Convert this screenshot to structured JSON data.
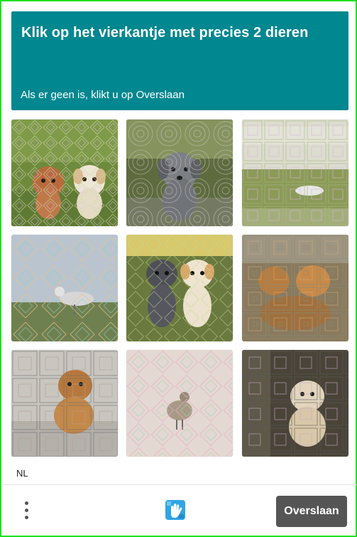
{
  "header": {
    "title": "Klik op het vierkantje met precies 2 dieren",
    "subtitle": "Als er geen is, klikt u op Overslaan",
    "background": "#00878f"
  },
  "grid": {
    "tiles": [
      {
        "id": 1,
        "content": "two puppies on grass"
      },
      {
        "id": 2,
        "content": "grey puppy"
      },
      {
        "id": 3,
        "content": "bird on field"
      },
      {
        "id": 4,
        "content": "seagull"
      },
      {
        "id": 5,
        "content": "two puppies"
      },
      {
        "id": 6,
        "content": "dogs"
      },
      {
        "id": 7,
        "content": "puppy"
      },
      {
        "id": 8,
        "content": "bird"
      },
      {
        "id": 9,
        "content": "puppy"
      }
    ]
  },
  "footer": {
    "language": "NL",
    "menu_icon": "kebab-menu-icon",
    "logo_icon": "hcaptcha-hand-logo",
    "skip_label": "Overslaan",
    "skip_color": "#555555"
  },
  "frame_border_color": "#22e022"
}
